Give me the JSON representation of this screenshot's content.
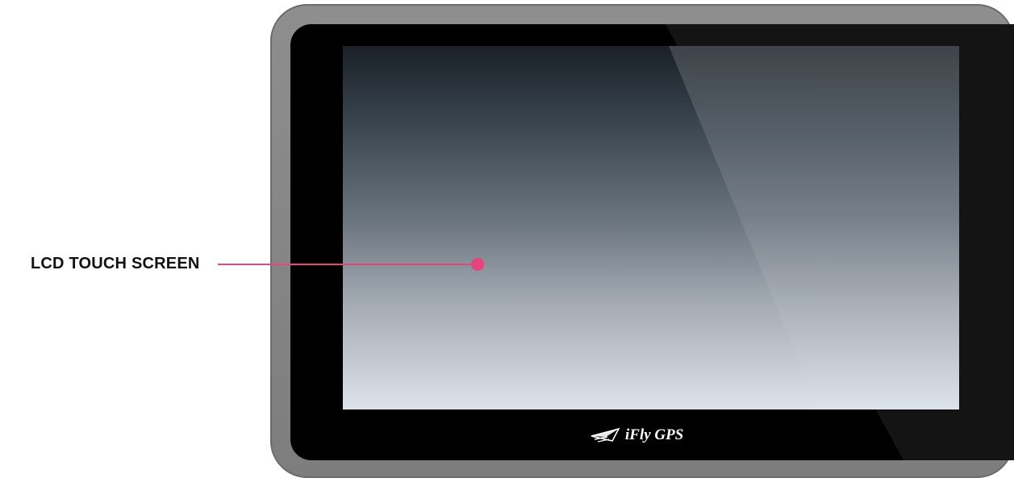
{
  "callout": {
    "label": "LCD TOUCH SCREEN",
    "color": "#e8437c"
  },
  "device": {
    "brand": "iFly GPS",
    "brand_icon": "paper-plane-logo-icon",
    "bezel_color": "#888888",
    "frame_color": "#000000"
  }
}
